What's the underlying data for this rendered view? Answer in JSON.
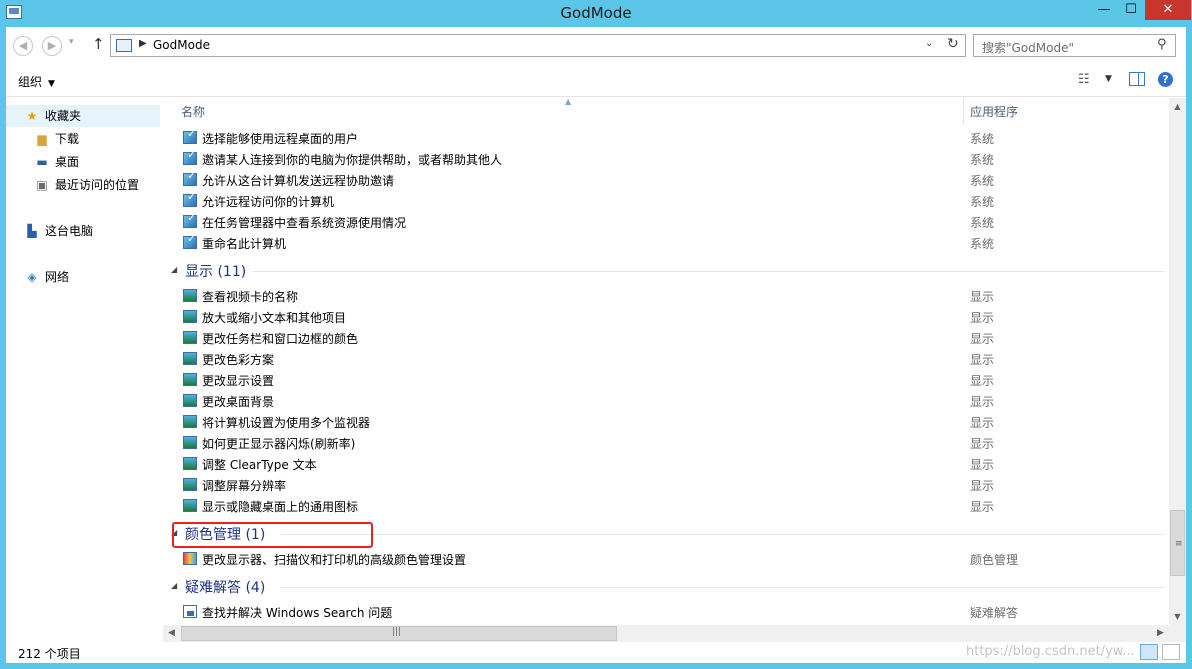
{
  "window": {
    "title": "GodMode",
    "controls": {
      "minimize": "—",
      "maximize": "☐",
      "close": "✕"
    }
  },
  "address": {
    "path": "GodMode",
    "search_placeholder": "搜索\"GodMode\""
  },
  "toolbar": {
    "organize_label": "组织"
  },
  "nav": {
    "favorites": "收藏夹",
    "downloads": "下载",
    "desktop": "桌面",
    "recent": "最近访问的位置",
    "this_pc": "这台电脑",
    "network": "网络"
  },
  "columns": {
    "name": "名称",
    "app": "应用程序"
  },
  "sections": [
    {
      "items": [
        {
          "name": "选择能够使用远程桌面的用户",
          "app": "系统"
        },
        {
          "name": "邀请某人连接到你的电脑为你提供帮助，或者帮助其他人",
          "app": "系统"
        },
        {
          "name": "允许从这台计算机发送远程协助邀请",
          "app": "系统"
        },
        {
          "name": "允许远程访问你的计算机",
          "app": "系统"
        },
        {
          "name": "在任务管理器中查看系统资源使用情况",
          "app": "系统"
        },
        {
          "name": "重命名此计算机",
          "app": "系统"
        }
      ]
    },
    {
      "label": "显示 (11)",
      "items": [
        {
          "name": "查看视频卡的名称",
          "app": "显示"
        },
        {
          "name": "放大或缩小文本和其他项目",
          "app": "显示"
        },
        {
          "name": "更改任务栏和窗口边框的颜色",
          "app": "显示"
        },
        {
          "name": "更改色彩方案",
          "app": "显示"
        },
        {
          "name": "更改显示设置",
          "app": "显示"
        },
        {
          "name": "更改桌面背景",
          "app": "显示"
        },
        {
          "name": "将计算机设置为使用多个监视器",
          "app": "显示"
        },
        {
          "name": "如何更正显示器闪烁(刷新率)",
          "app": "显示"
        },
        {
          "name": "调整 ClearType 文本",
          "app": "显示"
        },
        {
          "name": "调整屏幕分辨率",
          "app": "显示"
        },
        {
          "name": "显示或隐藏桌面上的通用图标",
          "app": "显示"
        }
      ]
    },
    {
      "label": "颜色管理 (1)",
      "items": [
        {
          "name": "更改显示器、扫描仪和打印机的高级颜色管理设置",
          "app": "颜色管理"
        }
      ]
    },
    {
      "label": "疑难解答 (4)",
      "items": [
        {
          "name": "查找并解决 Windows Search 问题",
          "app": "疑难解答"
        }
      ]
    }
  ],
  "status": {
    "count": "212 个项目",
    "watermark": "https://blog.csdn.net/yw..."
  }
}
